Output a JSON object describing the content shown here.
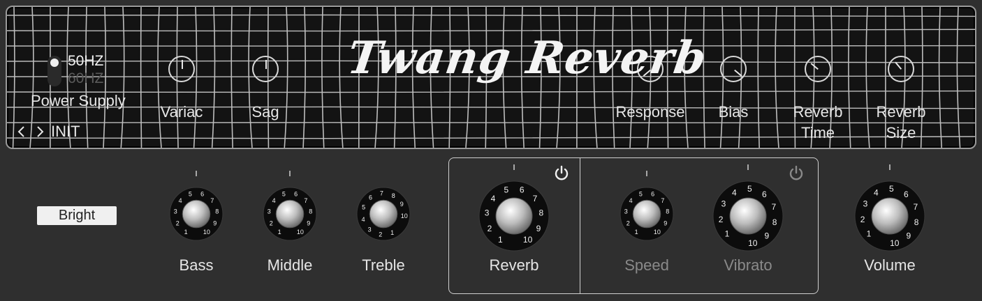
{
  "header": {
    "title": "Twang Reverb",
    "preset_name": "INIT",
    "power_supply": {
      "label": "Power Supply",
      "option_50": "50HZ",
      "option_60": "60HZ",
      "selected": "50HZ"
    },
    "knobs": [
      {
        "id": "variac",
        "label": "Variac"
      },
      {
        "id": "sag",
        "label": "Sag"
      },
      {
        "id": "response",
        "label": "Response"
      },
      {
        "id": "bias",
        "label": "Bias"
      },
      {
        "id": "reverb_time",
        "label": "Reverb\nTime"
      },
      {
        "id": "reverb_size",
        "label": "Reverb\nSize"
      }
    ]
  },
  "controls": {
    "bright_label": "Bright",
    "bass_label": "Bass",
    "middle_label": "Middle",
    "treble_label": "Treble",
    "reverb_label": "Reverb",
    "speed_label": "Speed",
    "vibrato_label": "Vibrato",
    "volume_label": "Volume",
    "dial_numbers": [
      "1",
      "2",
      "3",
      "4",
      "5",
      "6",
      "7",
      "8",
      "9",
      "10"
    ]
  },
  "colors": {
    "background": "#2f2f2f",
    "grille": "#131313",
    "label": "#e6e6e6",
    "disabled_label": "#8a8a8a",
    "button_bg": "#f0f0f0"
  },
  "icons": {
    "prev": "chevron-left-icon",
    "next": "chevron-right-icon",
    "power": "power-icon"
  }
}
